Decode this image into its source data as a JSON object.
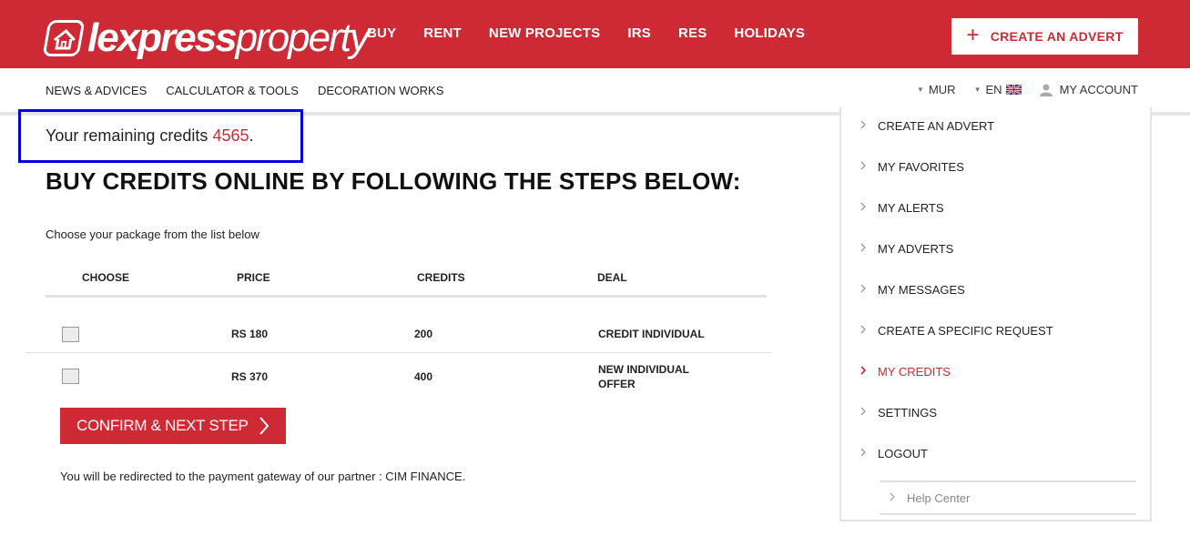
{
  "brand": {
    "logo_bold": "lexpress",
    "logo_light": "property",
    "accent": "#cd2a35"
  },
  "main_nav": [
    "BUY",
    "RENT",
    "NEW PROJECTS",
    "IRS",
    "RES",
    "HOLIDAYS"
  ],
  "create_advert_button": "CREATE AN ADVERT",
  "sub_nav": [
    "NEWS & ADVICES",
    "CALCULATOR & TOOLS",
    "DECORATION WORKS"
  ],
  "currency": "MUR",
  "language": "EN",
  "my_account": "MY ACCOUNT",
  "credits": {
    "prefix": "Your remaining credits",
    "value": "4565",
    "suffix": "."
  },
  "heading": "BUY CREDITS ONLINE BY FOLLOWING THE STEPS BELOW:",
  "intro": "Choose your package from the list below",
  "table": {
    "headers": [
      "CHOOSE",
      "PRICE",
      "CREDITS",
      "DEAL"
    ],
    "rows": [
      {
        "price": "RS 180",
        "credits": "200",
        "deal_line1": "CREDIT INDIVIDUAL",
        "deal_line2": "",
        "checked": false
      },
      {
        "price": "RS 370",
        "credits": "400",
        "deal_line1": "NEW INDIVIDUAL",
        "deal_line2": "OFFER",
        "checked": false
      }
    ]
  },
  "confirm_button": "CONFIRM & NEXT STEP",
  "redirect_note": "You will be redirected to the payment gateway of our partner : CIM FINANCE.",
  "account_menu": {
    "items": [
      "CREATE AN ADVERT",
      "MY FAVORITES",
      "MY ALERTS",
      "MY ADVERTS",
      "MY MESSAGES",
      "CREATE A SPECIFIC REQUEST",
      "MY CREDITS",
      "SETTINGS",
      "LOGOUT"
    ],
    "active": "MY CREDITS",
    "help": "Help Center"
  }
}
